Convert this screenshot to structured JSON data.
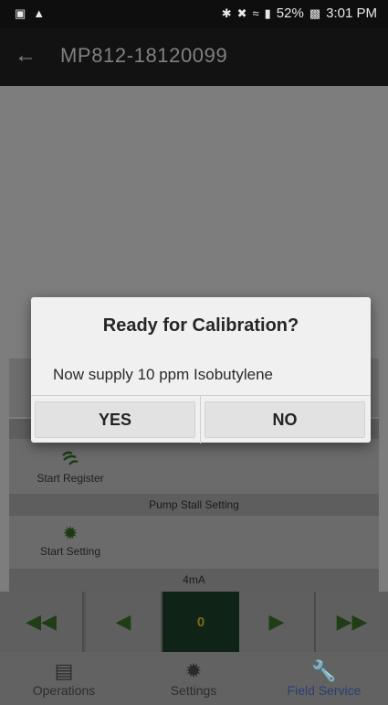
{
  "status_bar": {
    "battery": "52%",
    "time": "3:01 PM",
    "icons": [
      "image-icon",
      "drive-icon",
      "bluetooth-icon",
      "mute-icon",
      "wifi-icon",
      "signal-icon",
      "battery-icon"
    ]
  },
  "app_bar": {
    "title": "MP812-18120099"
  },
  "sections": {
    "register_action": "Start Register",
    "pump_stall_header": "Pump Stall Setting",
    "setting_action": "Start Setting",
    "current_header": "4mA"
  },
  "stepper": {
    "value": "0"
  },
  "bottom_nav": {
    "items": [
      {
        "label": "Operations",
        "icon": "calendar-icon"
      },
      {
        "label": "Settings",
        "icon": "gear-icon"
      },
      {
        "label": "Field Service",
        "icon": "wrench-icon"
      }
    ],
    "active": "Field Service"
  },
  "dialog": {
    "title": "Ready for Calibration?",
    "message": "Now supply 10 ppm Isobutylene",
    "yes_label": "YES",
    "no_label": "NO"
  },
  "colors": {
    "active_nav": "#2b3f73",
    "accent_green": "#1c3a12",
    "display_bg": "#0f2416",
    "dialog_bg": "#f0f0f0"
  }
}
